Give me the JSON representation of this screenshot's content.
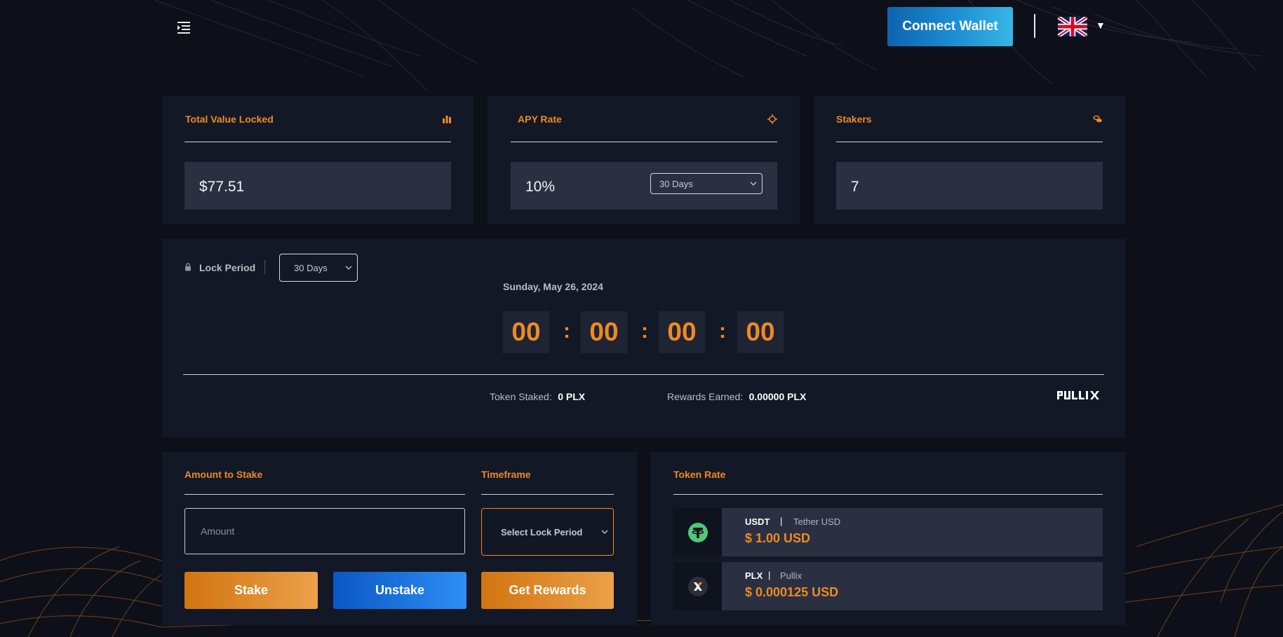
{
  "header": {
    "connect_label": "Connect Wallet",
    "language_flag": "uk-flag-icon"
  },
  "stats": {
    "tvl": {
      "title": "Total Value Locked",
      "value": "$77.51",
      "icon": "bar-chart-icon"
    },
    "apy": {
      "title": "APY Rate",
      "value": "10%",
      "period": "30 Days",
      "icon": "crosshair-icon"
    },
    "stakers": {
      "title": "Stakers",
      "value": "7",
      "icon": "coins-icon"
    }
  },
  "lock": {
    "label": "Lock Period",
    "selected": "30 Days",
    "date": "Sunday, May 26, 2024",
    "countdown": [
      "00",
      "00",
      "00",
      "00"
    ],
    "separator": ":",
    "token_staked_label": "Token Staked:",
    "token_staked_value": "0 PLX",
    "rewards_label": "Rewards Earned:",
    "rewards_value": "0.00000 PLX",
    "brand": "PULLIX"
  },
  "stake": {
    "amount_title": "Amount to Stake",
    "amount_placeholder": "Amount",
    "timeframe_title": "Timeframe",
    "timeframe_placeholder": "Select Lock Period",
    "stake_label": "Stake",
    "unstake_label": "Unstake",
    "rewards_label": "Get Rewards"
  },
  "token_rate": {
    "title": "Token Rate",
    "tokens": [
      {
        "symbol": "USDT",
        "pipe": "|",
        "name": "Tether USD",
        "price": "$ 1.00 USD",
        "icon": "tether-icon"
      },
      {
        "symbol": "PLX",
        "pipe": "|",
        "name": "Pullix",
        "price": "$ 0.000125 USD",
        "icon": "pullix-icon"
      }
    ]
  },
  "colors": {
    "accent": "#ee8a22",
    "card_bg": "#131826",
    "value_bg": "#2a3041",
    "page_bg": "#0d1019",
    "primary_blue": "#1d8fd3"
  }
}
